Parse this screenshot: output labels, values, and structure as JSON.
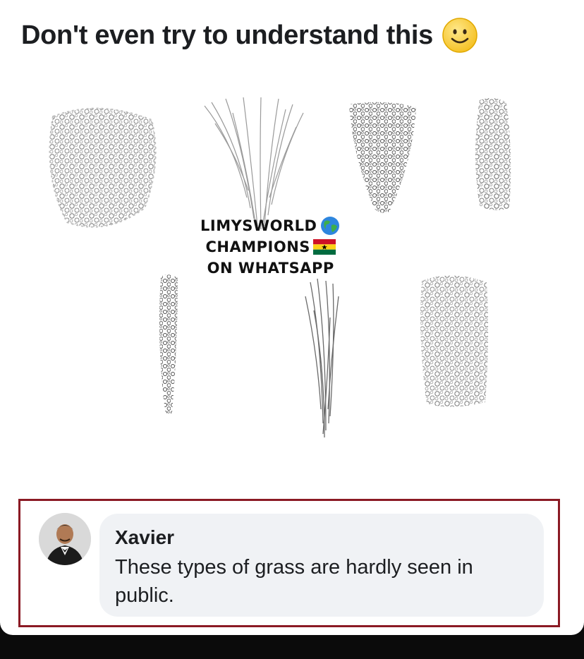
{
  "post": {
    "title": "Don't even try to understand this",
    "title_emoji_icon": "slightly-smiling-face-icon"
  },
  "watermark": {
    "line1": "LIMYSWORLD",
    "line1_icon": "globe-icon",
    "line2": "CHAMPIONS",
    "line2_icon": "ghana-flag-icon",
    "line3": "ON WHATSAPP"
  },
  "comment": {
    "author": "Xavier",
    "text": "These types of grass are hardly seen in public.",
    "avatar_icon": "man-in-tuxedo-avatar"
  },
  "colors": {
    "highlight_border": "#8b1a24",
    "bubble_bg": "#f0f2f5",
    "text": "#1c1e21"
  }
}
